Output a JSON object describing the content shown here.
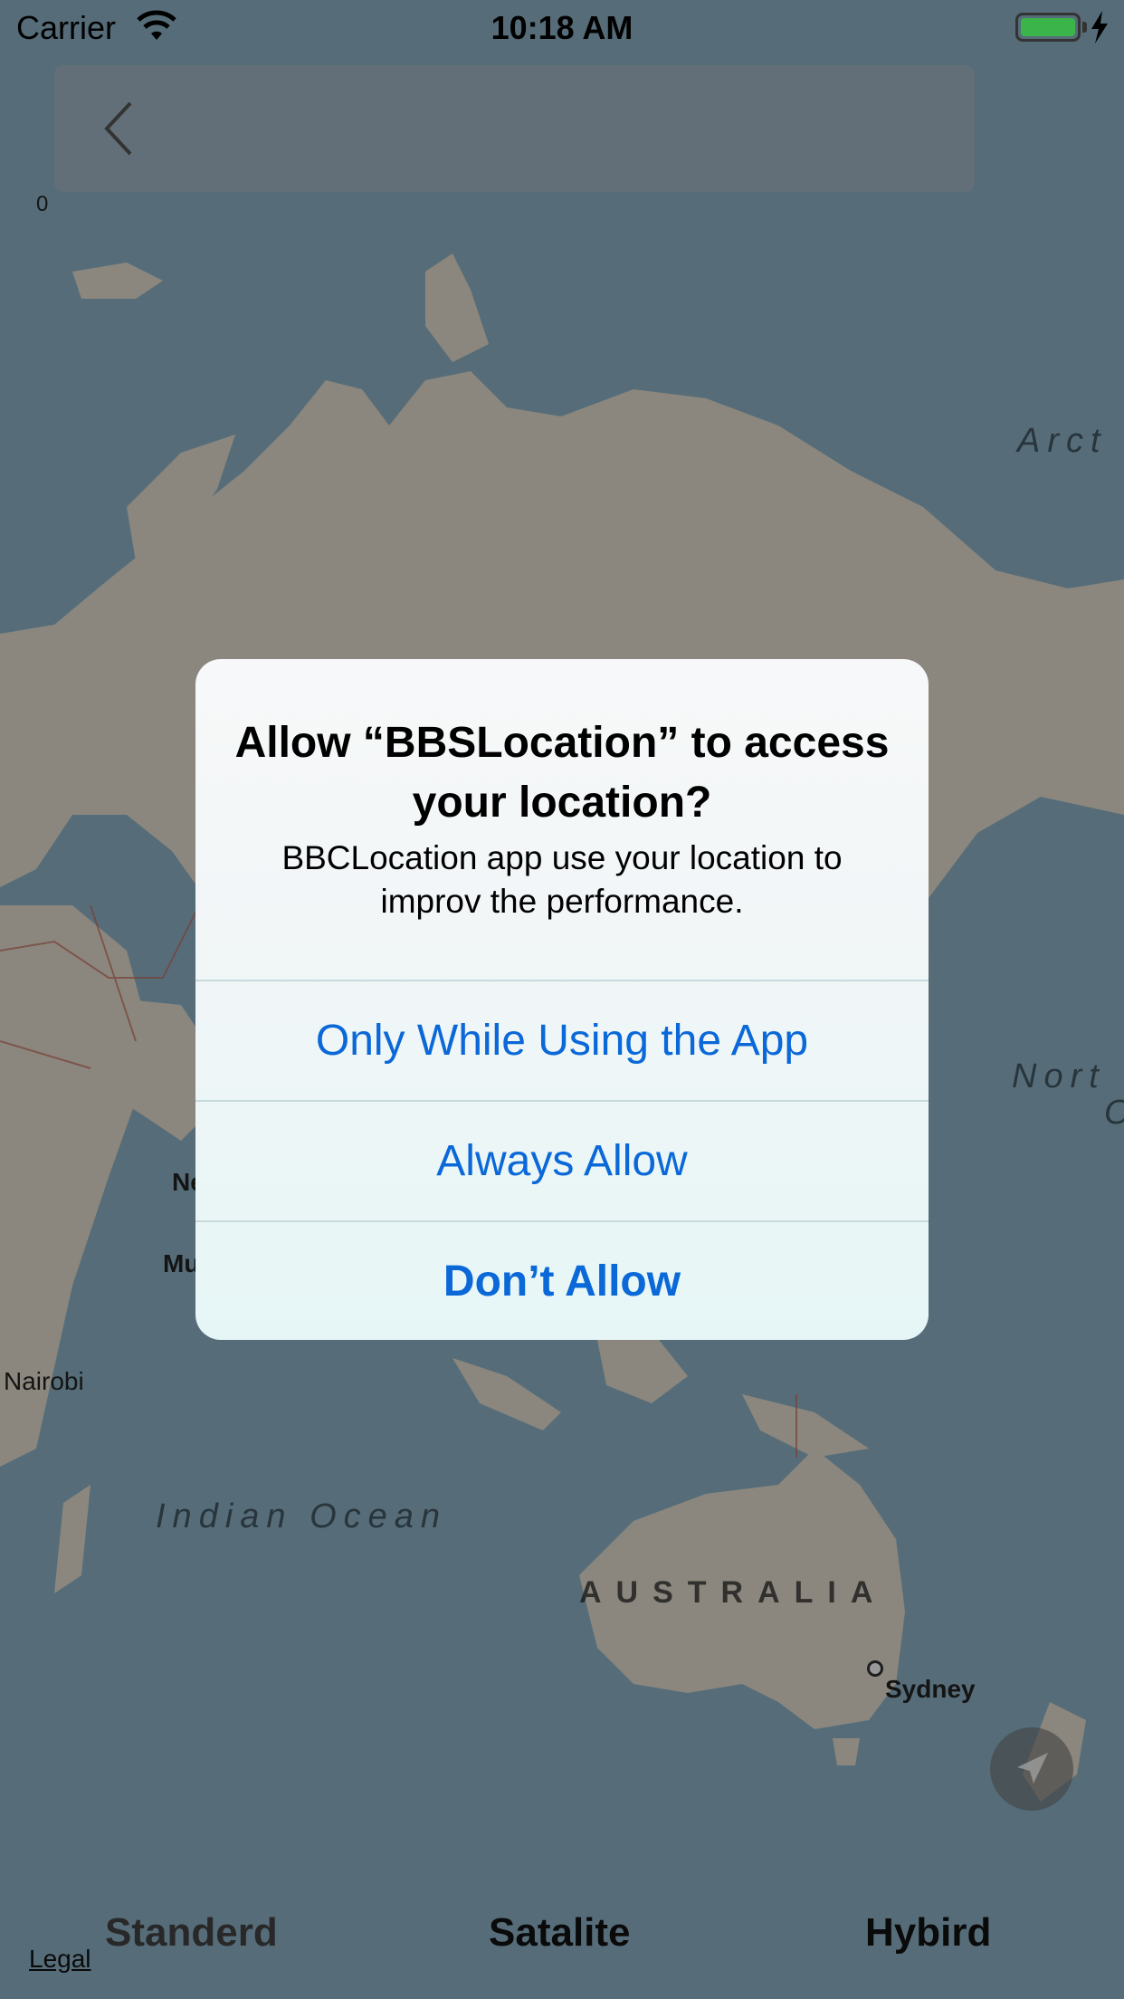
{
  "status_bar": {
    "carrier": "Carrier",
    "time": "10:18 AM"
  },
  "top_nav": {
    "back_icon": "chevron-left-icon",
    "zoom_label": "0"
  },
  "map": {
    "labels": {
      "arctic": "Arct",
      "indian_ocean": "Indian Ocean",
      "australia": "AUSTRALIA",
      "north": "Nort",
      "north_cont": "O",
      "nairobi": "Nairobi",
      "sydney": "Sydney",
      "ne": "Ne",
      "mu": "Mu"
    },
    "legal": "Legal"
  },
  "segments": {
    "standard": "Standerd",
    "satellite": "Satalite",
    "hybrid": "Hybird"
  },
  "alert": {
    "title": "Allow “BBSLocation” to access your location?",
    "message": "BBCLocation app use your location to improv the performance.",
    "buttons": {
      "while_using": "Only While Using the App",
      "always": "Always Allow",
      "dont": "Don’t Allow"
    }
  },
  "colors": {
    "accent": "#0a68d8",
    "battery": "#3bb54a",
    "ocean": "#8fb6ca",
    "land": "#e9e2d4"
  }
}
